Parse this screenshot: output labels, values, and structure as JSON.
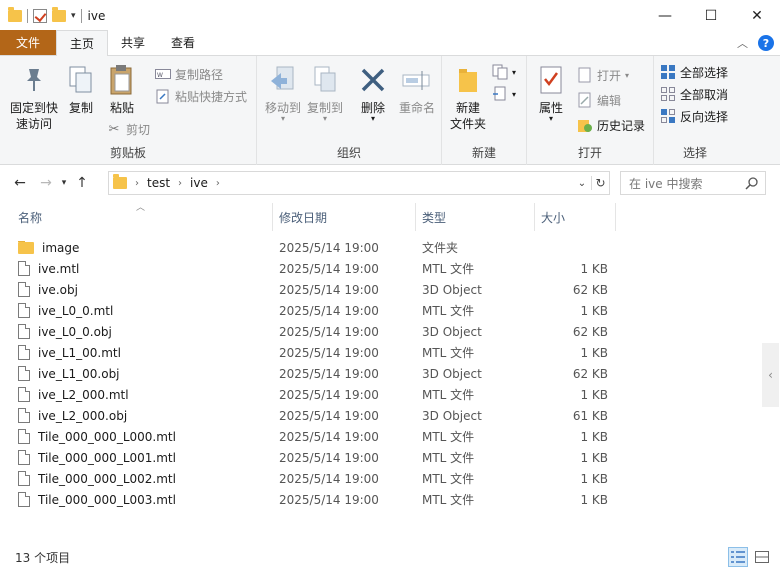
{
  "window": {
    "title": "ive",
    "controls": {
      "minimize": "—",
      "maximize": "☐",
      "close": "✕"
    }
  },
  "tabs": [
    {
      "label": "文件",
      "kind": "file"
    },
    {
      "label": "主页",
      "kind": "active"
    },
    {
      "label": "共享",
      "kind": ""
    },
    {
      "label": "查看",
      "kind": ""
    }
  ],
  "ribbon": {
    "clipboard": {
      "label": "剪贴板",
      "pin": "固定到快\n速访问",
      "copy": "复制",
      "paste": "粘贴",
      "copy_path": "复制路径",
      "paste_shortcut": "粘贴快捷方式",
      "cut": "剪切"
    },
    "organize": {
      "label": "组织",
      "move_to": "移动到",
      "copy_to": "复制到",
      "delete": "删除",
      "rename": "重命名"
    },
    "new": {
      "label": "新建",
      "new_folder": "新建\n文件夹"
    },
    "open": {
      "label": "打开",
      "properties": "属性",
      "open": "打开",
      "edit": "编辑",
      "history": "历史记录"
    },
    "select": {
      "label": "选择",
      "select_all": "全部选择",
      "select_none": "全部取消",
      "invert": "反向选择"
    }
  },
  "address": {
    "path": [
      "test",
      "ive"
    ],
    "search_placeholder": "在 ive 中搜索"
  },
  "columns": {
    "name": "名称",
    "date": "修改日期",
    "type": "类型",
    "size": "大小"
  },
  "files": [
    {
      "name": "image",
      "date": "2025/5/14 19:00",
      "type": "文件夹",
      "size": "",
      "kind": "folder"
    },
    {
      "name": "ive.mtl",
      "date": "2025/5/14 19:00",
      "type": "MTL 文件",
      "size": "1 KB",
      "kind": "file"
    },
    {
      "name": "ive.obj",
      "date": "2025/5/14 19:00",
      "type": "3D Object",
      "size": "62 KB",
      "kind": "file"
    },
    {
      "name": "ive_L0_0.mtl",
      "date": "2025/5/14 19:00",
      "type": "MTL 文件",
      "size": "1 KB",
      "kind": "file"
    },
    {
      "name": "ive_L0_0.obj",
      "date": "2025/5/14 19:00",
      "type": "3D Object",
      "size": "62 KB",
      "kind": "file"
    },
    {
      "name": "ive_L1_00.mtl",
      "date": "2025/5/14 19:00",
      "type": "MTL 文件",
      "size": "1 KB",
      "kind": "file"
    },
    {
      "name": "ive_L1_00.obj",
      "date": "2025/5/14 19:00",
      "type": "3D Object",
      "size": "62 KB",
      "kind": "file"
    },
    {
      "name": "ive_L2_000.mtl",
      "date": "2025/5/14 19:00",
      "type": "MTL 文件",
      "size": "1 KB",
      "kind": "file"
    },
    {
      "name": "ive_L2_000.obj",
      "date": "2025/5/14 19:00",
      "type": "3D Object",
      "size": "61 KB",
      "kind": "file"
    },
    {
      "name": "Tile_000_000_L000.mtl",
      "date": "2025/5/14 19:00",
      "type": "MTL 文件",
      "size": "1 KB",
      "kind": "file"
    },
    {
      "name": "Tile_000_000_L001.mtl",
      "date": "2025/5/14 19:00",
      "type": "MTL 文件",
      "size": "1 KB",
      "kind": "file"
    },
    {
      "name": "Tile_000_000_L002.mtl",
      "date": "2025/5/14 19:00",
      "type": "MTL 文件",
      "size": "1 KB",
      "kind": "file"
    },
    {
      "name": "Tile_000_000_L003.mtl",
      "date": "2025/5/14 19:00",
      "type": "MTL 文件",
      "size": "1 KB",
      "kind": "file"
    }
  ],
  "status": {
    "count": "13 个项目"
  },
  "colors": {
    "file_tab": "#b36618",
    "folder": "#f6c34a",
    "accent": "#1a73e8"
  }
}
